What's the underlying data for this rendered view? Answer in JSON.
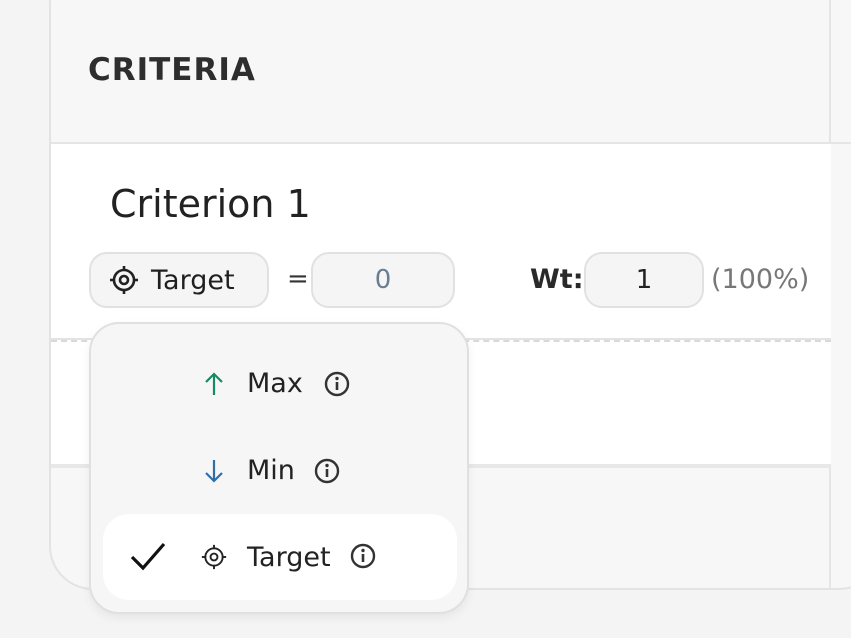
{
  "panel": {
    "title": "CRITERIA"
  },
  "criterion": {
    "name": "Criterion 1",
    "goal_label": "Target",
    "equals": "=",
    "target_value": "0",
    "weight_label": "Wt:",
    "weight_value": "1",
    "weight_percent": "(100%)"
  },
  "dropdown": {
    "options": [
      {
        "label": "Max",
        "icon": "arrow-up-icon",
        "color": "#168a63",
        "selected": false
      },
      {
        "label": "Min",
        "icon": "arrow-down-icon",
        "color": "#2f6fa8",
        "selected": false
      },
      {
        "label": "Target",
        "icon": "target-icon",
        "color": "#222222",
        "selected": true
      }
    ]
  }
}
